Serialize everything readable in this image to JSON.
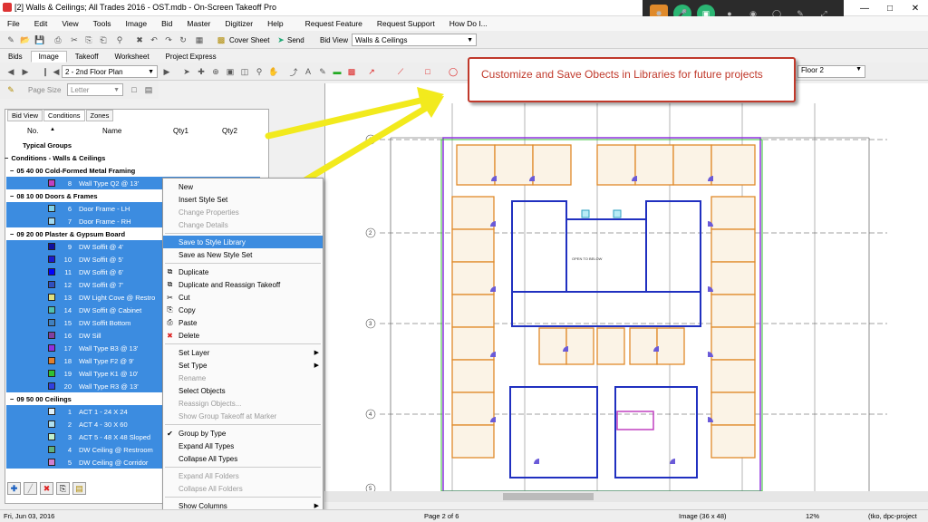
{
  "window": {
    "title": "[2] Walls & Ceilings; All Trades 2016 - OST.mdb - On-Screen Takeoff Pro"
  },
  "menu": [
    "File",
    "Edit",
    "View",
    "Tools",
    "Image",
    "Bid",
    "Master",
    "Digitizer",
    "Help",
    "Request Feature",
    "Request Support",
    "How Do I..."
  ],
  "toolbar1": {
    "cover_sheet": "Cover Sheet",
    "send": "Send",
    "bid_view": "Bid View",
    "bid_select": "Walls & Ceilings"
  },
  "tabs": [
    "Bids",
    "Image",
    "Takeoff",
    "Worksheet",
    "Project Express"
  ],
  "toolbar2": {
    "page_select": "2 - 2nd Floor Plan",
    "floor_select": "Floor 2"
  },
  "toolbar3": {
    "page_size_label": "Page Size",
    "page_size_value": "Letter"
  },
  "left_tabs": [
    "Bid View",
    "Conditions",
    "Zones"
  ],
  "columns": {
    "no": "No.",
    "name": "Name",
    "qty1": "Qty1",
    "qty2": "Qty2"
  },
  "rows": [
    {
      "kind": "grp",
      "text": "Typical Groups",
      "indent": 10
    },
    {
      "kind": "grp",
      "text": "Conditions - Walls & Ceilings",
      "indent": 4,
      "sym": "−"
    },
    {
      "kind": "grp",
      "text": "05 40 00 Cold-Formed Metal Framing",
      "indent": 10,
      "sym": "−"
    },
    {
      "kind": "item",
      "no": "8",
      "text": "Wall Type Q2 @ 13'",
      "color": "#c040c0"
    },
    {
      "kind": "grp",
      "text": "08 10 00 Doors & Frames",
      "indent": 10,
      "sym": "−"
    },
    {
      "kind": "item",
      "no": "6",
      "text": "Door Frame - LH",
      "color": "#80d0e8"
    },
    {
      "kind": "item",
      "no": "7",
      "text": "Door Frame - RH",
      "color": "#a0d8f0"
    },
    {
      "kind": "grp",
      "text": "09 20 00 Plaster & Gypsum Board",
      "indent": 10,
      "sym": "−"
    },
    {
      "kind": "item",
      "no": "9",
      "text": "DW Soffit @ 4'",
      "color": "#1010a0"
    },
    {
      "kind": "item",
      "no": "10",
      "text": "DW Soffit @ 5'",
      "color": "#1a1ad0"
    },
    {
      "kind": "item",
      "no": "11",
      "text": "DW Soffit @ 6'",
      "color": "#0000ff"
    },
    {
      "kind": "item",
      "no": "12",
      "text": "DW Soffit @ 7'",
      "color": "#3050c0"
    },
    {
      "kind": "item",
      "no": "13",
      "text": "DW Light Cove @ Restro",
      "color": "#e0e080"
    },
    {
      "kind": "item",
      "no": "14",
      "text": "DW Soffit @ Cabinet",
      "color": "#50c0b0"
    },
    {
      "kind": "item",
      "no": "15",
      "text": "DW Soffit Bottom",
      "color": "#4080c0"
    },
    {
      "kind": "item",
      "no": "16",
      "text": "DW Sill",
      "color": "#8040a0"
    },
    {
      "kind": "item",
      "no": "17",
      "text": "Wall Type B3 @ 13'",
      "color": "#9030e0"
    },
    {
      "kind": "item",
      "no": "18",
      "text": "Wall Type F2 @ 9'",
      "color": "#e08030"
    },
    {
      "kind": "item",
      "no": "19",
      "text": "Wall Type K1 @ 10'",
      "color": "#30c030"
    },
    {
      "kind": "item",
      "no": "20",
      "text": "Wall Type R3 @ 13'",
      "color": "#3040e0"
    },
    {
      "kind": "grp",
      "text": "09 50 00 Ceilings",
      "indent": 10,
      "sym": "−"
    },
    {
      "kind": "item",
      "no": "1",
      "text": "ACT 1 - 24 X 24",
      "color": "#e0f0f8"
    },
    {
      "kind": "item",
      "no": "2",
      "text": "ACT 4 - 30 X 60",
      "color": "#b0e0f0"
    },
    {
      "kind": "item",
      "no": "3",
      "text": "ACT 5 - 48 X 48 Sloped",
      "color": "#c0f0d0"
    },
    {
      "kind": "item",
      "no": "4",
      "text": "DW Ceiling @ Restroom",
      "color": "#60b080"
    },
    {
      "kind": "item",
      "no": "5",
      "text": "DW Ceiling @ Corridor",
      "color": "#d080d0"
    }
  ],
  "context_menu": [
    {
      "label": "New",
      "state": "normal"
    },
    {
      "label": "Insert Style Set",
      "state": "normal"
    },
    {
      "label": "Change Properties",
      "state": "dis"
    },
    {
      "label": "Change Details",
      "state": "dis"
    },
    {
      "sep": true
    },
    {
      "label": "Save to Style Library",
      "state": "hl"
    },
    {
      "label": "Save as New Style Set",
      "state": "normal"
    },
    {
      "sep": true
    },
    {
      "label": "Duplicate",
      "state": "normal",
      "icon": "⧉"
    },
    {
      "label": "Duplicate and Reassign Takeoff",
      "state": "normal",
      "icon": "⧉"
    },
    {
      "label": "Cut",
      "state": "normal",
      "icon": "✂"
    },
    {
      "label": "Copy",
      "state": "normal",
      "icon": "⎘"
    },
    {
      "label": "Paste",
      "state": "normal",
      "icon": "⎙"
    },
    {
      "label": "Delete",
      "state": "normal",
      "icon": "✖",
      "iconcolor": "#d22"
    },
    {
      "sep": true
    },
    {
      "label": "Set Layer",
      "state": "normal",
      "sub": true
    },
    {
      "label": "Set Type",
      "state": "normal",
      "sub": true
    },
    {
      "label": "Rename",
      "state": "dis"
    },
    {
      "label": "Select Objects",
      "state": "normal"
    },
    {
      "label": "Reassign Objects...",
      "state": "dis"
    },
    {
      "label": "Show Group Takeoff at Marker",
      "state": "dis"
    },
    {
      "sep": true
    },
    {
      "label": "Group by Type",
      "state": "normal",
      "icon": "✔"
    },
    {
      "label": "Expand All Types",
      "state": "normal"
    },
    {
      "label": "Collapse All Types",
      "state": "normal"
    },
    {
      "sep": true
    },
    {
      "label": "Expand All Folders",
      "state": "dis"
    },
    {
      "label": "Collapse All Folders",
      "state": "dis"
    },
    {
      "sep": true
    },
    {
      "label": "Show Columns",
      "state": "normal",
      "sub": true
    }
  ],
  "callout": {
    "text": "Customize and Save Obects in Libraries for future projects"
  },
  "status": {
    "date": "Fri, Jun 03, 2016",
    "page": "Page 2 of 6",
    "image": "Image (36 x 48)",
    "zoom": "12%",
    "user": "(tko, dpc-project"
  },
  "plan": {
    "grid_numbers": [
      "1",
      "2",
      "3",
      "4",
      "5"
    ],
    "rooms": "OPEN TO BELOW"
  },
  "colors": {
    "accent": "#3c8ce0",
    "callout": "#c0392b",
    "arrow": "#f2ea1d"
  }
}
